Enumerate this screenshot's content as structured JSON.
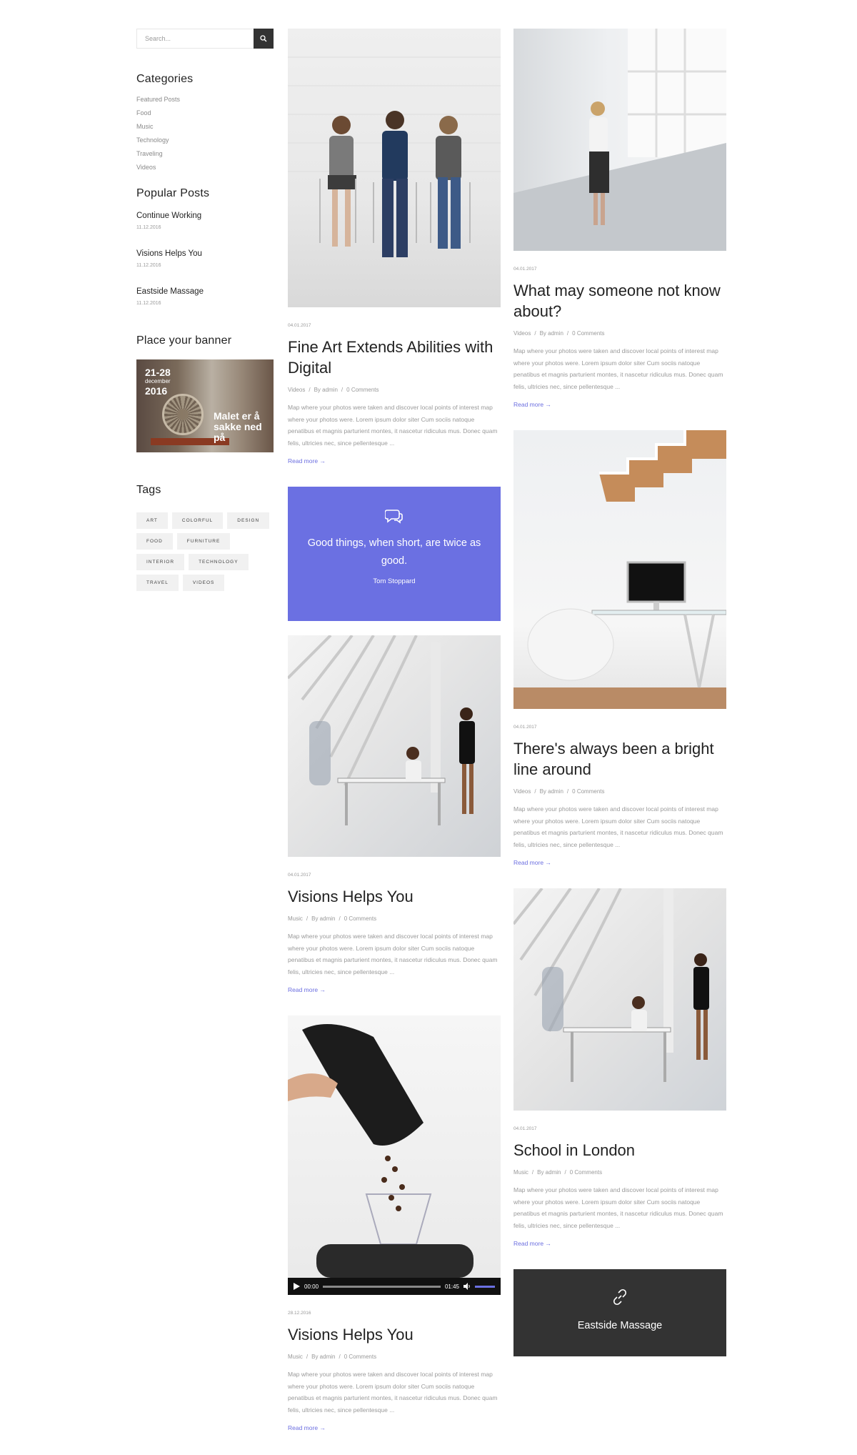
{
  "search": {
    "placeholder": "Search..."
  },
  "categories": {
    "title": "Categories",
    "items": [
      "Featured Posts",
      "Food",
      "Music",
      "Technology",
      "Traveling",
      "Videos"
    ]
  },
  "popular": {
    "title": "Popular Posts",
    "items": [
      {
        "title": "Continue Working",
        "date": "11.12.2016"
      },
      {
        "title": "Visions Helps You",
        "date": "11.12.2016"
      },
      {
        "title": "Eastside Massage",
        "date": "11.12.2016"
      }
    ]
  },
  "banner": {
    "title": "Place your banner",
    "date_range": "21-28",
    "month": "december",
    "year": "2016",
    "text": "Malet er å sakke ned på"
  },
  "tags": {
    "title": "Tags",
    "items": [
      "ART",
      "COLORFUL",
      "DESIGN",
      "FOOD",
      "FURNITURE",
      "INTERIOR",
      "TECHNOLOGY",
      "TRAVEL",
      "VIDEOS"
    ]
  },
  "excerpt": "Map where your photos were taken and discover local points of interest map where your photos were. Lorem ipsum dolor siter Cum sociis natoque penatibus et magnis parturient montes, it nascetur ridiculus mus. Donec quam felis, ultricies nec, since pellentesque ...",
  "read_more": "Read more",
  "posts_left": [
    {
      "date": "04.01.2017",
      "title": "Fine Art Extends Abilities with Digital",
      "category": "Videos",
      "author": "By admin",
      "comments": "0 Comments"
    },
    {
      "date": "04.01.2017",
      "title": "Visions Helps You",
      "category": "Music",
      "author": "By admin",
      "comments": "0 Comments"
    },
    {
      "date": "28.12.2016",
      "title": "Visions Helps You",
      "category": "Music",
      "author": "By admin",
      "comments": "0 Comments"
    }
  ],
  "posts_right": [
    {
      "date": "04.01.2017",
      "title": "What may someone not know about?",
      "category": "Videos",
      "author": "By admin",
      "comments": "0 Comments"
    },
    {
      "date": "04.01.2017",
      "title": "There's always been a bright line around",
      "category": "Videos",
      "author": "By admin",
      "comments": "0 Comments"
    },
    {
      "date": "04.01.2017",
      "title": "School in London",
      "category": "Music",
      "author": "By admin",
      "comments": "0 Comments"
    }
  ],
  "quote": {
    "text": "Good things, when short, are twice as good.",
    "author": "Tom Stoppard"
  },
  "link_post": {
    "text": "Eastside Massage"
  },
  "video": {
    "current": "00:00",
    "duration": "01:45"
  },
  "colors": {
    "accent": "#6b70e2",
    "dark": "#333333"
  }
}
